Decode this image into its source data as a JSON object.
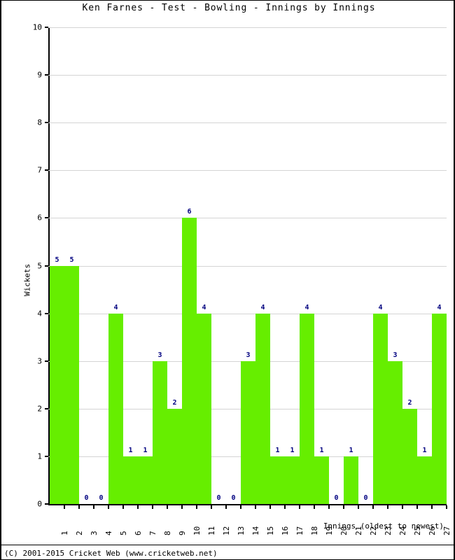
{
  "chart_data": {
    "type": "bar",
    "title": "Ken Farnes - Test - Bowling - Innings by Innings",
    "xlabel": "Innings (oldest to newest)",
    "ylabel": "Wickets",
    "categories": [
      "1",
      "2",
      "3",
      "4",
      "5",
      "6",
      "7",
      "8",
      "9",
      "10",
      "11",
      "12",
      "13",
      "14",
      "15",
      "16",
      "17",
      "18",
      "19",
      "20",
      "21",
      "22",
      "23",
      "24",
      "25",
      "26",
      "27"
    ],
    "values": [
      5,
      5,
      0,
      0,
      4,
      1,
      1,
      3,
      2,
      6,
      4,
      0,
      0,
      3,
      4,
      1,
      1,
      4,
      1,
      0,
      1,
      0,
      4,
      3,
      2,
      1,
      4
    ],
    "ylim": [
      0,
      10
    ],
    "yticks": [
      0,
      1,
      2,
      3,
      4,
      5,
      6,
      7,
      8,
      9,
      10
    ],
    "ytick_labels": [
      "0",
      "1",
      "2",
      "3",
      "4",
      "5",
      "6",
      "7",
      "8",
      "9",
      "10"
    ],
    "grid": true,
    "legend": "none",
    "bar_color": "#66ee00",
    "value_label_color": "#000080",
    "axis_color": "#000000",
    "gridline_color": "#d4d4d4",
    "show_value_labels": true
  },
  "footer": {
    "copyright": "(C) 2001-2015 Cricket Web (www.cricketweb.net)"
  }
}
